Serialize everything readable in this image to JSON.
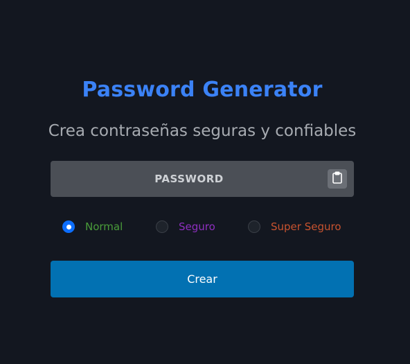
{
  "header": {
    "title": "Password Generator",
    "subtitle": "Crea contraseñas seguras y confiables"
  },
  "password": {
    "value": "PASSWORD",
    "copy_icon": "clipboard-icon"
  },
  "options": [
    {
      "label": "Normal",
      "checked": true,
      "color": "#4a9d3a"
    },
    {
      "label": "Seguro",
      "checked": false,
      "color": "#8e2fc0"
    },
    {
      "label": "Super Seguro",
      "checked": false,
      "color": "#c8532f"
    }
  ],
  "actions": {
    "create_label": "Crear"
  },
  "colors": {
    "background": "#131720",
    "title": "#3b82f6",
    "button": "#0271b2",
    "radio_checked": "#0d6efd"
  }
}
